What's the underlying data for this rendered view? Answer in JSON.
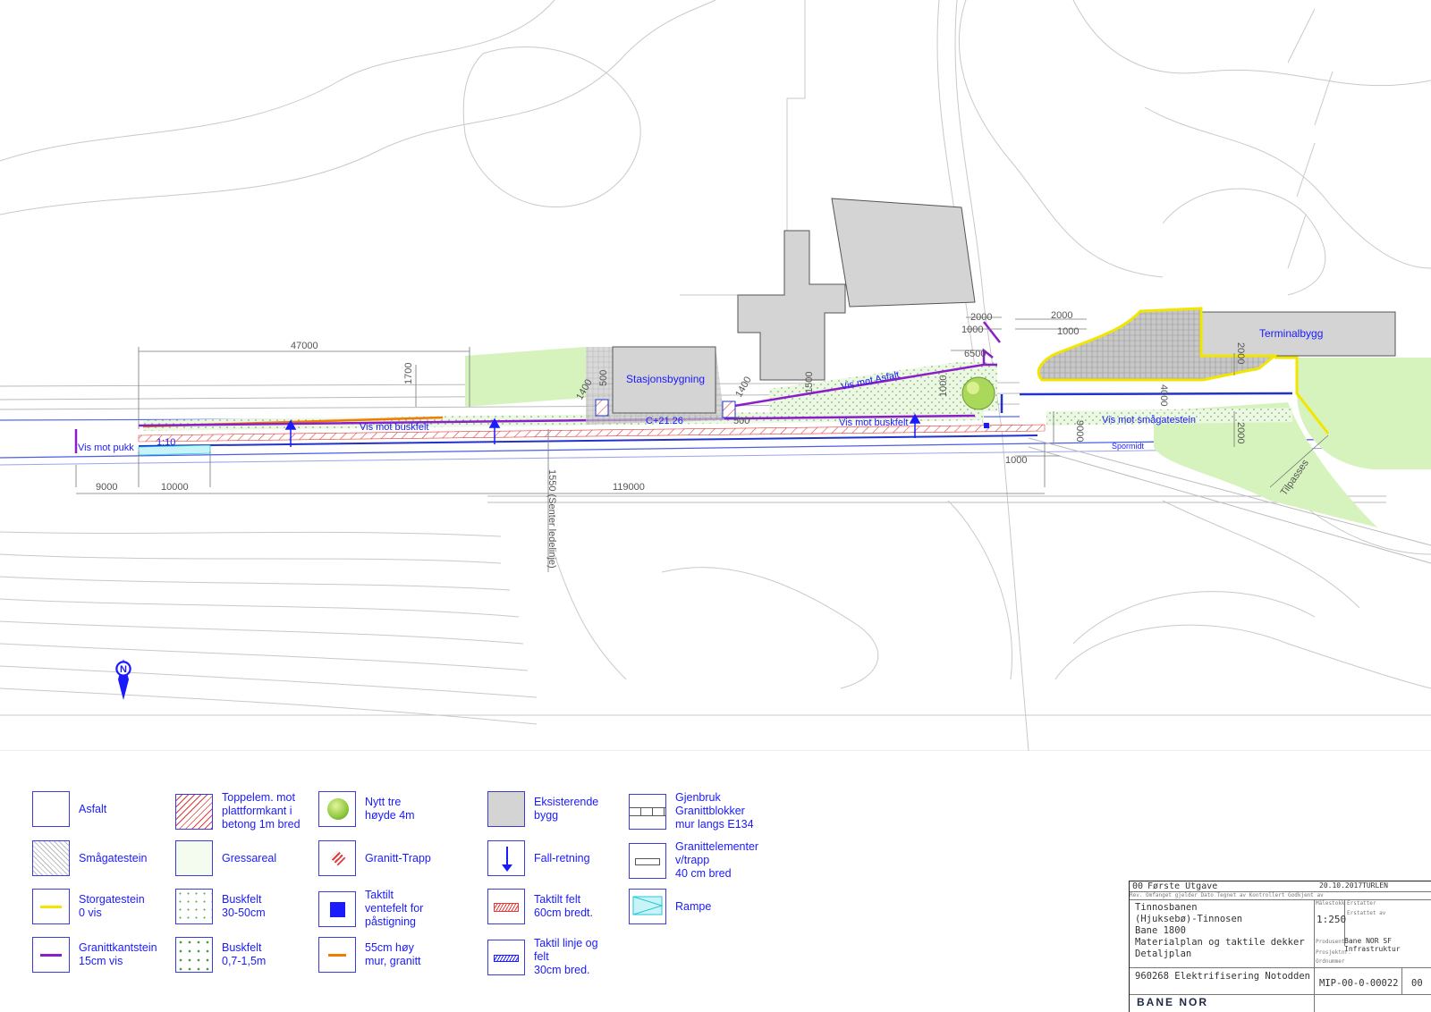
{
  "plan": {
    "dimensions": [
      "47000",
      "1700",
      "9000",
      "10000",
      "119000",
      "1550 (Senter ledelinje)",
      "1400",
      "500",
      "C+21.26",
      "1400",
      "1500",
      "500",
      "1000",
      "6500",
      "1000",
      "2000",
      "1000",
      "2000",
      "1000",
      "2000",
      "4000",
      "2000",
      "9000",
      "1000"
    ],
    "buildings": {
      "station": "Stasjonsbygning",
      "terminal": "Terminalbygg"
    },
    "annotations": {
      "vis_mot_pukk": "Vis mot pukk",
      "slope": "1:10",
      "vis_mot_buskfelt_1": "Vis mot buskfelt",
      "vis_mot_buskfelt_2": "Vis mot buskfelt",
      "vis_mot_asfalt": "Vis mot Asfalt",
      "vis_mot_smagatestein": "Vis mot smågatestein",
      "spormidt": "Spormidt",
      "tilpasses": "Tilpasses",
      "north": "N"
    }
  },
  "legend": [
    {
      "swatch": "blank",
      "label": "Asfalt"
    },
    {
      "swatch": "hatch-red",
      "label": "Toppelem. mot\nplattformkant i\nbetong 1m bred"
    },
    {
      "swatch": "tree",
      "label": "Nytt tre\nhøyde 4m"
    },
    {
      "swatch": "grey",
      "label": "Eksisterende\nbygg"
    },
    {
      "swatch": "granite-blocks",
      "label": "Gjenbruk\nGranittblokker\nmur langs E134"
    },
    {
      "swatch": "cobble",
      "label": "Smågatestein"
    },
    {
      "swatch": "grass",
      "label": "Gressareal"
    },
    {
      "swatch": "stairs",
      "label": "Granitt-Trapp"
    },
    {
      "swatch": "arrow",
      "label": "Fall-retning"
    },
    {
      "swatch": "granite-element",
      "label": "Granittelementer\nv/trapp\n40 cm bred"
    },
    {
      "swatch": "yellow-line",
      "label": "Storgatestein\n0 vis"
    },
    {
      "swatch": "dots",
      "label": "Buskfelt\n30-50cm"
    },
    {
      "swatch": "blue-square",
      "label": "Taktilt\nventefelt for\npåstigning"
    },
    {
      "swatch": "red-tactile",
      "label": "Taktilt felt\n60cm bredt."
    },
    {
      "swatch": "ramp",
      "label": "Rampe"
    },
    {
      "swatch": "purple-line",
      "label": "Granittkantstein\n15cm vis"
    },
    {
      "swatch": "green-triangles",
      "label": "Buskfelt\n0,7-1,5m"
    },
    {
      "swatch": "orange-line",
      "label": "55cm høy\nmur, granitt"
    },
    {
      "swatch": "blue-tactile",
      "label": "Taktil linje og\nfelt\n30cm bred."
    }
  ],
  "titleblock": {
    "rev": "00",
    "rev_text": "Første Utgave",
    "date": "20.10.2017",
    "sign": "TURLEN",
    "header_small": "Rev. Omfanget gjelder  Dato  Tegnet av  Kontrollert  Godkjent av",
    "project_lines": [
      "Tinnosbanen",
      "(Hjuksebø)-Tinnosen",
      "Bane 1800",
      "Materialplan og taktile dekker",
      "Detaljplan"
    ],
    "scale": "1:250",
    "scale_small": [
      "Målestokk",
      "Erstatter",
      "Erstattet av",
      "Produsent",
      "Prosjektnr.",
      "Ordnummer"
    ],
    "producer": "Bane NOR SF Infrastruktur",
    "project_no": "960268 Elektrifisering Notodden",
    "drawing_no": "MIP-00-0-00022",
    "drawing_rev": "00",
    "logo": "BANE NOR"
  },
  "colors": {
    "blue": "#1a1aff",
    "purple": "#8a1fc9",
    "grass": "#d7f3bd",
    "building": "#d4d4d4",
    "yellow": "#f2e600",
    "red": "#e23b3b",
    "orange": "#f07c00"
  }
}
